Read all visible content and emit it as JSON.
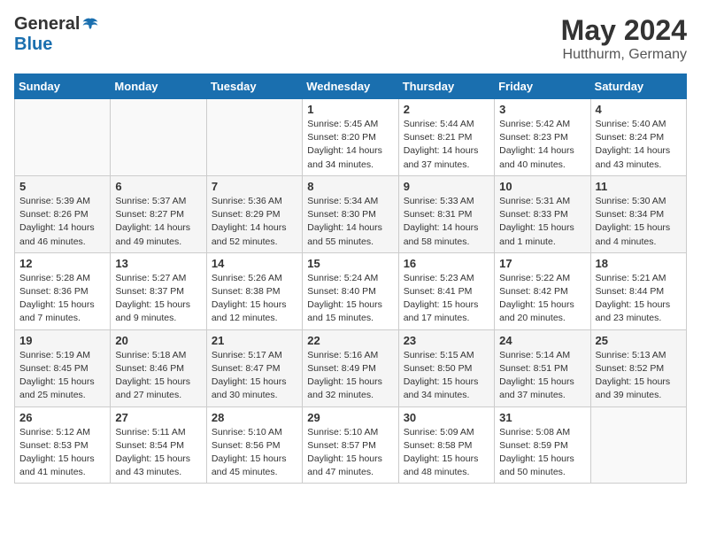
{
  "header": {
    "logo_general": "General",
    "logo_blue": "Blue",
    "month": "May 2024",
    "location": "Hutthurm, Germany"
  },
  "weekdays": [
    "Sunday",
    "Monday",
    "Tuesday",
    "Wednesday",
    "Thursday",
    "Friday",
    "Saturday"
  ],
  "weeks": [
    [
      {
        "day": "",
        "info": ""
      },
      {
        "day": "",
        "info": ""
      },
      {
        "day": "",
        "info": ""
      },
      {
        "day": "1",
        "info": "Sunrise: 5:45 AM\nSunset: 8:20 PM\nDaylight: 14 hours\nand 34 minutes."
      },
      {
        "day": "2",
        "info": "Sunrise: 5:44 AM\nSunset: 8:21 PM\nDaylight: 14 hours\nand 37 minutes."
      },
      {
        "day": "3",
        "info": "Sunrise: 5:42 AM\nSunset: 8:23 PM\nDaylight: 14 hours\nand 40 minutes."
      },
      {
        "day": "4",
        "info": "Sunrise: 5:40 AM\nSunset: 8:24 PM\nDaylight: 14 hours\nand 43 minutes."
      }
    ],
    [
      {
        "day": "5",
        "info": "Sunrise: 5:39 AM\nSunset: 8:26 PM\nDaylight: 14 hours\nand 46 minutes."
      },
      {
        "day": "6",
        "info": "Sunrise: 5:37 AM\nSunset: 8:27 PM\nDaylight: 14 hours\nand 49 minutes."
      },
      {
        "day": "7",
        "info": "Sunrise: 5:36 AM\nSunset: 8:29 PM\nDaylight: 14 hours\nand 52 minutes."
      },
      {
        "day": "8",
        "info": "Sunrise: 5:34 AM\nSunset: 8:30 PM\nDaylight: 14 hours\nand 55 minutes."
      },
      {
        "day": "9",
        "info": "Sunrise: 5:33 AM\nSunset: 8:31 PM\nDaylight: 14 hours\nand 58 minutes."
      },
      {
        "day": "10",
        "info": "Sunrise: 5:31 AM\nSunset: 8:33 PM\nDaylight: 15 hours\nand 1 minute."
      },
      {
        "day": "11",
        "info": "Sunrise: 5:30 AM\nSunset: 8:34 PM\nDaylight: 15 hours\nand 4 minutes."
      }
    ],
    [
      {
        "day": "12",
        "info": "Sunrise: 5:28 AM\nSunset: 8:36 PM\nDaylight: 15 hours\nand 7 minutes."
      },
      {
        "day": "13",
        "info": "Sunrise: 5:27 AM\nSunset: 8:37 PM\nDaylight: 15 hours\nand 9 minutes."
      },
      {
        "day": "14",
        "info": "Sunrise: 5:26 AM\nSunset: 8:38 PM\nDaylight: 15 hours\nand 12 minutes."
      },
      {
        "day": "15",
        "info": "Sunrise: 5:24 AM\nSunset: 8:40 PM\nDaylight: 15 hours\nand 15 minutes."
      },
      {
        "day": "16",
        "info": "Sunrise: 5:23 AM\nSunset: 8:41 PM\nDaylight: 15 hours\nand 17 minutes."
      },
      {
        "day": "17",
        "info": "Sunrise: 5:22 AM\nSunset: 8:42 PM\nDaylight: 15 hours\nand 20 minutes."
      },
      {
        "day": "18",
        "info": "Sunrise: 5:21 AM\nSunset: 8:44 PM\nDaylight: 15 hours\nand 23 minutes."
      }
    ],
    [
      {
        "day": "19",
        "info": "Sunrise: 5:19 AM\nSunset: 8:45 PM\nDaylight: 15 hours\nand 25 minutes."
      },
      {
        "day": "20",
        "info": "Sunrise: 5:18 AM\nSunset: 8:46 PM\nDaylight: 15 hours\nand 27 minutes."
      },
      {
        "day": "21",
        "info": "Sunrise: 5:17 AM\nSunset: 8:47 PM\nDaylight: 15 hours\nand 30 minutes."
      },
      {
        "day": "22",
        "info": "Sunrise: 5:16 AM\nSunset: 8:49 PM\nDaylight: 15 hours\nand 32 minutes."
      },
      {
        "day": "23",
        "info": "Sunrise: 5:15 AM\nSunset: 8:50 PM\nDaylight: 15 hours\nand 34 minutes."
      },
      {
        "day": "24",
        "info": "Sunrise: 5:14 AM\nSunset: 8:51 PM\nDaylight: 15 hours\nand 37 minutes."
      },
      {
        "day": "25",
        "info": "Sunrise: 5:13 AM\nSunset: 8:52 PM\nDaylight: 15 hours\nand 39 minutes."
      }
    ],
    [
      {
        "day": "26",
        "info": "Sunrise: 5:12 AM\nSunset: 8:53 PM\nDaylight: 15 hours\nand 41 minutes."
      },
      {
        "day": "27",
        "info": "Sunrise: 5:11 AM\nSunset: 8:54 PM\nDaylight: 15 hours\nand 43 minutes."
      },
      {
        "day": "28",
        "info": "Sunrise: 5:10 AM\nSunset: 8:56 PM\nDaylight: 15 hours\nand 45 minutes."
      },
      {
        "day": "29",
        "info": "Sunrise: 5:10 AM\nSunset: 8:57 PM\nDaylight: 15 hours\nand 47 minutes."
      },
      {
        "day": "30",
        "info": "Sunrise: 5:09 AM\nSunset: 8:58 PM\nDaylight: 15 hours\nand 48 minutes."
      },
      {
        "day": "31",
        "info": "Sunrise: 5:08 AM\nSunset: 8:59 PM\nDaylight: 15 hours\nand 50 minutes."
      },
      {
        "day": "",
        "info": ""
      }
    ]
  ]
}
